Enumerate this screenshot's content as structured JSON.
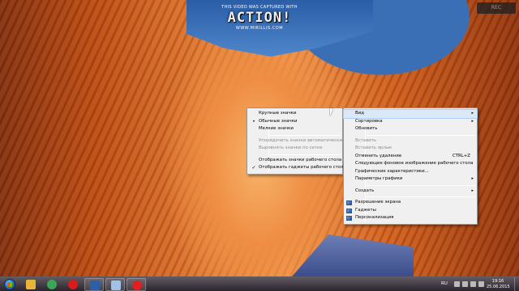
{
  "watermark": {
    "top_text": "THIS VIDEO WAS CAPTURED WITH",
    "logo": "ACTION!",
    "url": "WWW.MIRILLIS.COM"
  },
  "rec_badge": "REC",
  "context_menu": {
    "items": [
      {
        "label": "Вид",
        "submenu": true,
        "hover": true
      },
      {
        "label": "Сортировка",
        "submenu": true
      },
      {
        "label": "Обновить"
      },
      {
        "separator": true
      },
      {
        "label": "Вставить",
        "disabled": true
      },
      {
        "label": "Вставить ярлык",
        "disabled": true
      },
      {
        "label": "Отменить удаление",
        "shortcut": "CTRL+Z"
      },
      {
        "label": "Следующее фоновое изображение рабочего стола"
      },
      {
        "label": "Графические характеристики..."
      },
      {
        "label": "Параметры графики",
        "submenu": true
      },
      {
        "separator": true
      },
      {
        "label": "Создать",
        "submenu": true
      },
      {
        "separator": true
      },
      {
        "label": "Разрешение экрана",
        "icon": "screen-resolution-icon"
      },
      {
        "label": "Гаджеты",
        "icon": "gadgets-icon"
      },
      {
        "label": "Персонализация",
        "icon": "personalization-icon"
      }
    ]
  },
  "view_submenu": {
    "items": [
      {
        "label": "Крупные значки"
      },
      {
        "label": "Обычные значки",
        "mark": "•"
      },
      {
        "label": "Мелкие значки"
      },
      {
        "separator": true
      },
      {
        "label": "Упорядочить значки автоматически",
        "disabled": true
      },
      {
        "label": "Выровнять значки по сетке",
        "disabled": true
      },
      {
        "separator": true
      },
      {
        "label": "Отображать значки рабочего стола"
      },
      {
        "label": "Отображать гаджеты рабочего стола",
        "mark": "✓"
      }
    ]
  },
  "taskbar": {
    "apps": [
      {
        "name": "explorer",
        "icon": "folder-icon",
        "color": "#e8b53a"
      },
      {
        "name": "chrome",
        "icon": "chrome-icon",
        "color": "#3aa757"
      },
      {
        "name": "opera",
        "icon": "opera-icon",
        "color": "#d81b1b"
      },
      {
        "name": "app-dark",
        "icon": "media-icon",
        "color": "#2c5fa8"
      },
      {
        "name": "app-light",
        "icon": "window-icon",
        "color": "#9fc2e8"
      },
      {
        "name": "recorder",
        "icon": "record-icon",
        "color": "#e02020"
      }
    ],
    "tray": {
      "language": "RU",
      "time": "19:16",
      "date": "25.06.2015"
    }
  }
}
